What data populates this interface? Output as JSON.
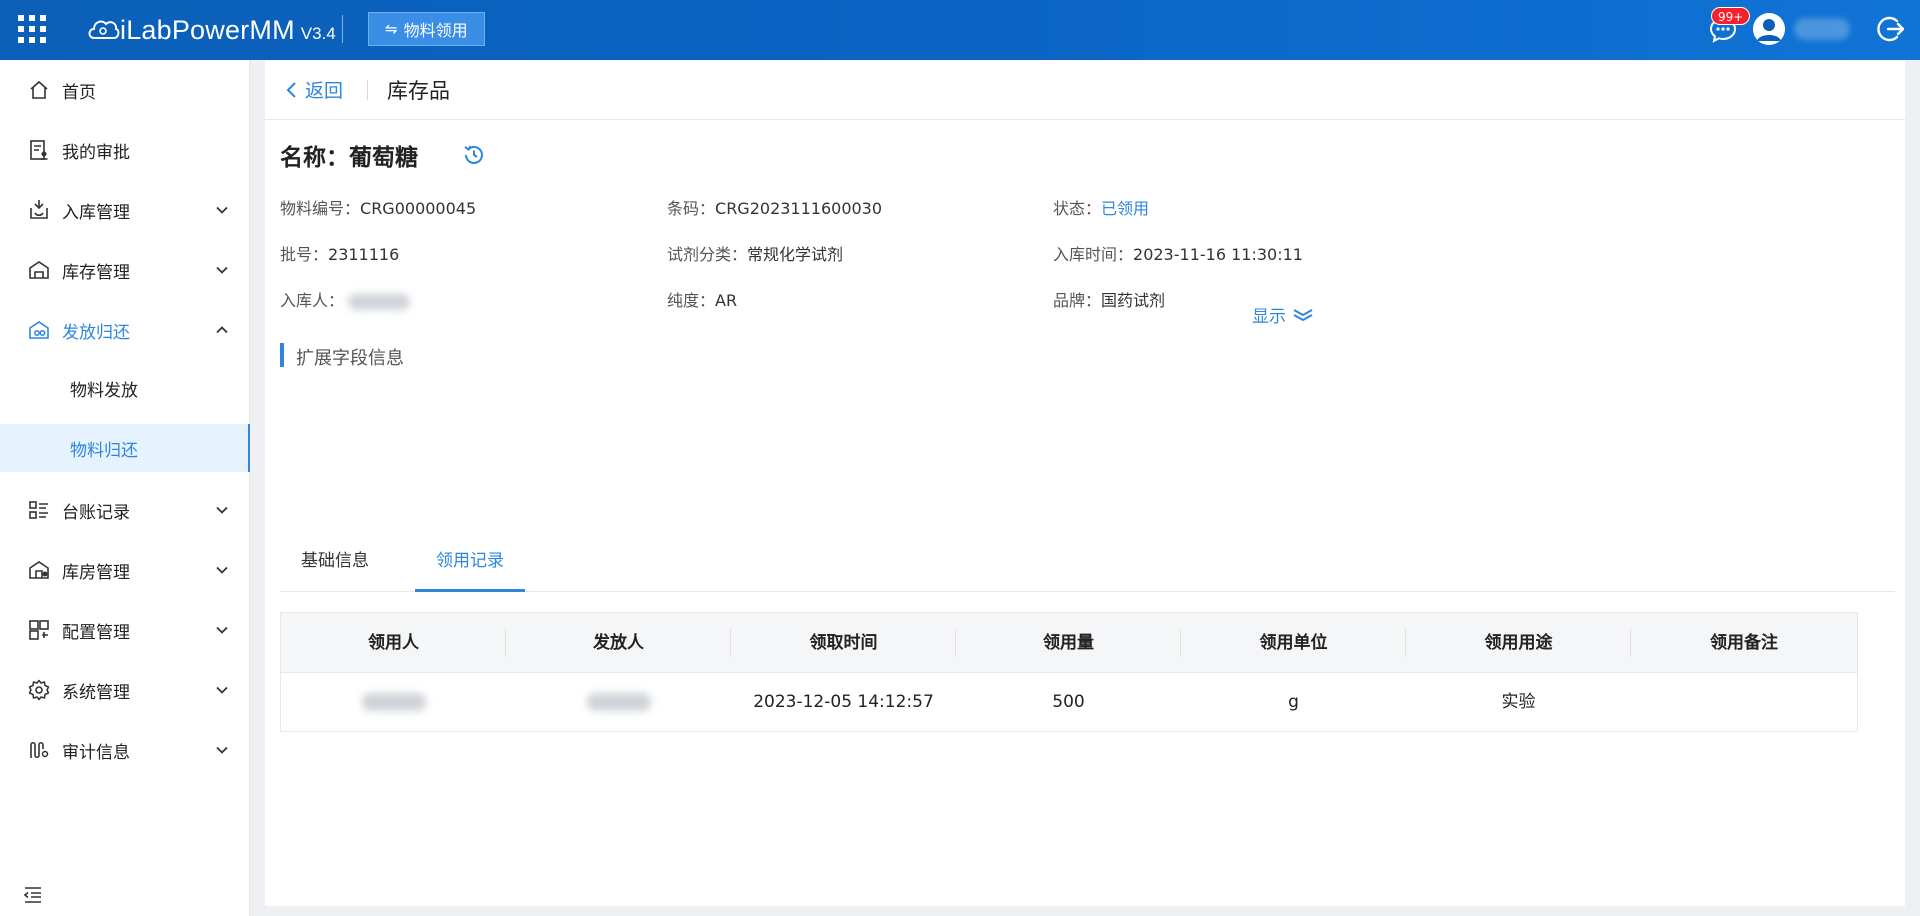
{
  "app": {
    "name": "iLabPowerMM",
    "version": "V3.4",
    "module": "物料领用",
    "notifications": "99+"
  },
  "sidebar": {
    "items": [
      {
        "label": "首页"
      },
      {
        "label": "我的审批"
      },
      {
        "label": "入库管理"
      },
      {
        "label": "库存管理"
      },
      {
        "label": "发放归还"
      },
      {
        "label": "物料发放"
      },
      {
        "label": "物料归还"
      },
      {
        "label": "台账记录"
      },
      {
        "label": "库房管理"
      },
      {
        "label": "配置管理"
      },
      {
        "label": "系统管理"
      },
      {
        "label": "审计信息"
      }
    ]
  },
  "header": {
    "back": "返回",
    "title": "库存品"
  },
  "item": {
    "title": "名称：葡萄糖",
    "code_label": "物料编号：",
    "code": "CRG00000045",
    "barcode_label": "条码：",
    "barcode": "CRG2023111600030",
    "status_label": "状态：",
    "status": "已领用",
    "batch_label": "批号：",
    "batch": "2311116",
    "category_label": "试剂分类：",
    "category": "常规化学试剂",
    "intime_label": "入库时间：",
    "intime": "2023-11-16 11:30:11",
    "receiver_label": "入库人：",
    "purity_label": "纯度：",
    "purity": "AR",
    "brand_label": "品牌：",
    "brand": "国药试剂",
    "show_more": "显示"
  },
  "ext": {
    "title": "扩展字段信息"
  },
  "tabs": [
    {
      "label": "基础信息"
    },
    {
      "label": "领用记录"
    }
  ],
  "table": {
    "columns": [
      "领用人",
      "发放人",
      "领取时间",
      "领用量",
      "领用单位",
      "领用用途",
      "领用备注"
    ],
    "rows": [
      {
        "time": "2023-12-05 14:12:57",
        "qty": "500",
        "unit": "g",
        "purpose": "实验",
        "note": ""
      }
    ]
  },
  "colors": {
    "accent": "#2e86de",
    "topbar": "#0a64c4"
  }
}
